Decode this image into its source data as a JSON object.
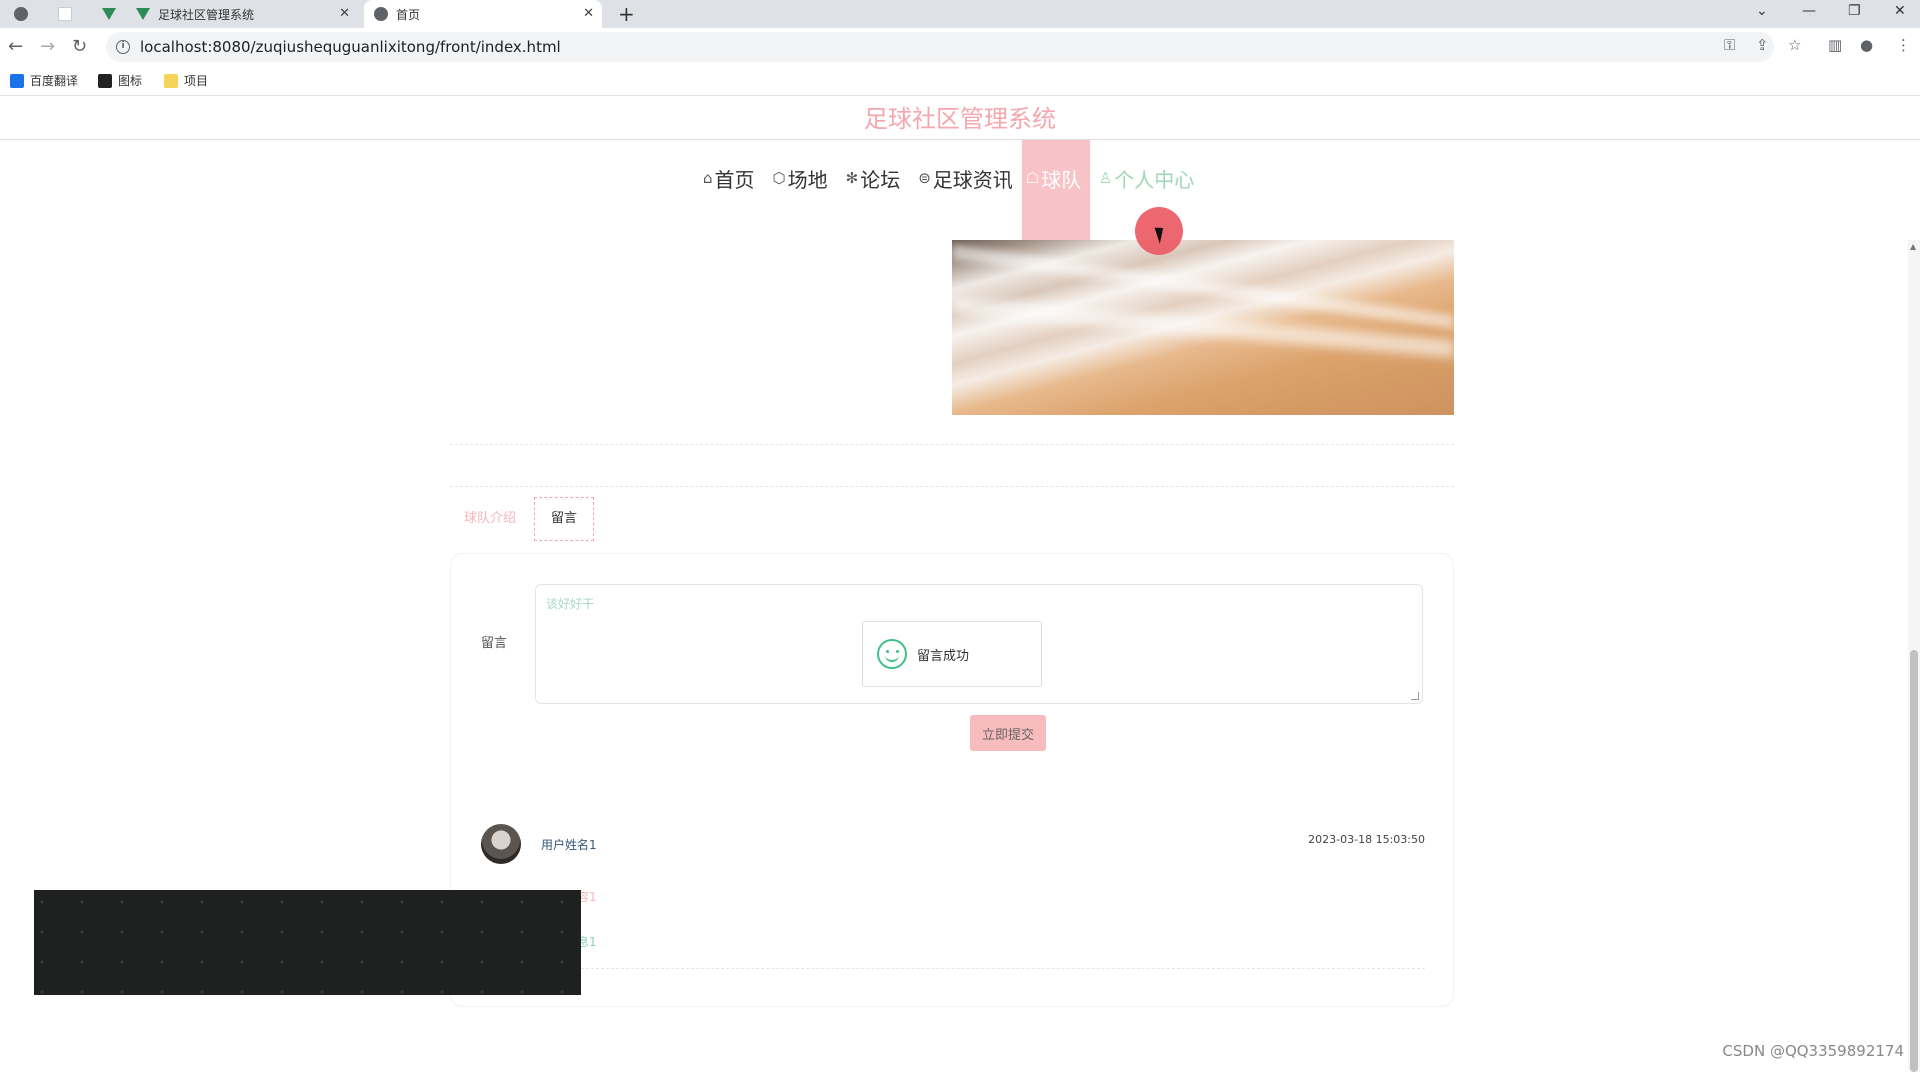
{
  "browser": {
    "tabs": [
      {
        "title": "",
        "icon": "globe-icon"
      },
      {
        "title": "",
        "icon": "mail-icon"
      },
      {
        "title": "",
        "icon": "vue-icon"
      },
      {
        "title": "足球社区管理系统",
        "icon": "vue-icon"
      },
      {
        "title": "首页",
        "icon": "globe-icon"
      }
    ],
    "url": "localhost:8080/zuqiushequguanlixitong/front/index.html",
    "bookmarks": [
      {
        "label": "百度翻译",
        "icon": "translate-icon",
        "color": "#1a73e8"
      },
      {
        "label": "图标",
        "icon": "image-icon",
        "color": "#222222"
      },
      {
        "label": "项目",
        "icon": "folder-icon",
        "color": "#f5d45a"
      }
    ]
  },
  "site": {
    "title": "足球社区管理系统"
  },
  "nav": {
    "items": [
      {
        "label": "首页",
        "icon": "home-icon"
      },
      {
        "label": "场地",
        "icon": "cube-icon"
      },
      {
        "label": "论坛",
        "icon": "snowflake-icon"
      },
      {
        "label": "足球资讯",
        "icon": "news-icon"
      },
      {
        "label": "球队",
        "icon": "team-icon"
      },
      {
        "label": "个人中心",
        "icon": "user-icon"
      }
    ],
    "active_index": 4
  },
  "detail_tabs": {
    "items": [
      "球队介绍",
      "留言"
    ],
    "active": "留言"
  },
  "comment_form": {
    "label": "留言",
    "value": "该好好干",
    "toast": "留言成功",
    "submit_label": "立即提交"
  },
  "comments": [
    {
      "user": "用户姓名1",
      "time": "2023-03-18 15:03:50",
      "content": "留言内容1",
      "reply": "回复信息1"
    }
  ],
  "watermark": "CSDN @QQ3359892174",
  "colors": {
    "accent_pink": "#f8c3c6",
    "title_pink": "#f4a7ad",
    "green_text": "#9fd6b8",
    "success_green": "#3fbf8a"
  }
}
